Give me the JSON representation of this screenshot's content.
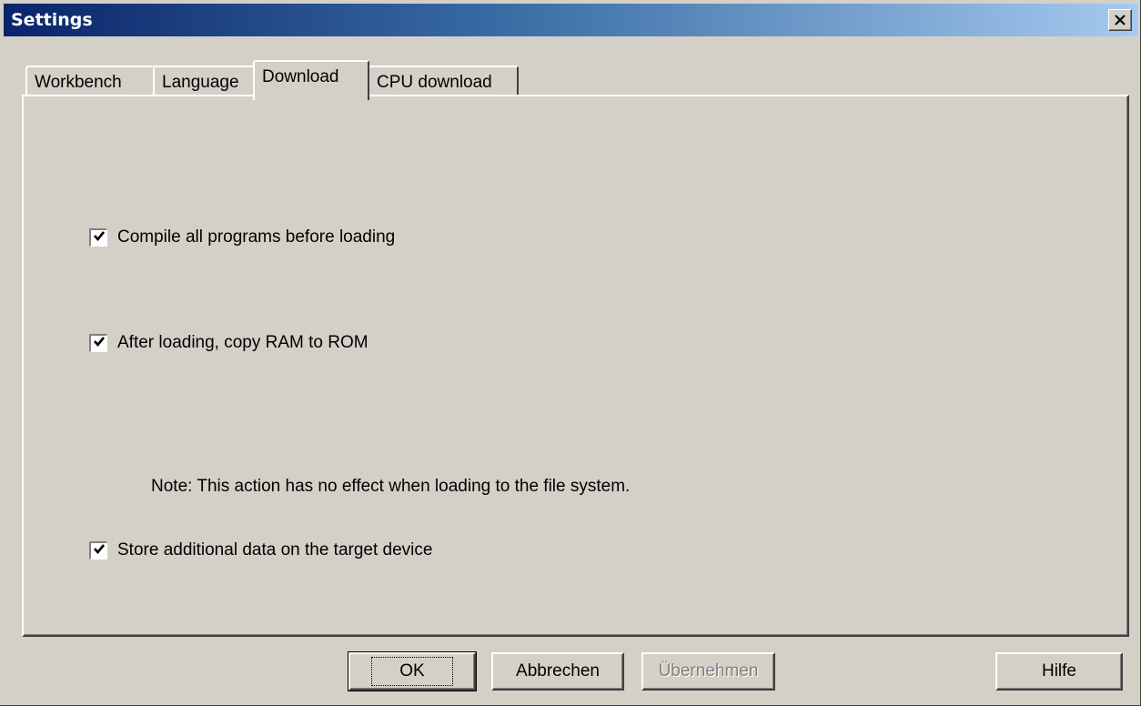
{
  "window": {
    "title": "Settings"
  },
  "tabs": [
    {
      "label": "Workbench",
      "active": false
    },
    {
      "label": "Language",
      "active": false
    },
    {
      "label": "Download",
      "active": true
    },
    {
      "label": "CPU download",
      "active": false
    }
  ],
  "options": [
    {
      "label": "Compile all programs before loading",
      "checked": true
    },
    {
      "label": "After loading, copy RAM to ROM",
      "checked": true
    },
    {
      "label": "Store additional data on the target device",
      "checked": true
    }
  ],
  "note": "Note: This action has no effect when loading to the file system.",
  "buttons": {
    "ok": "OK",
    "cancel": "Abbrechen",
    "apply": "Übernehmen",
    "help": "Hilfe"
  },
  "icons": {
    "close": "close-icon",
    "check": "check-icon"
  }
}
